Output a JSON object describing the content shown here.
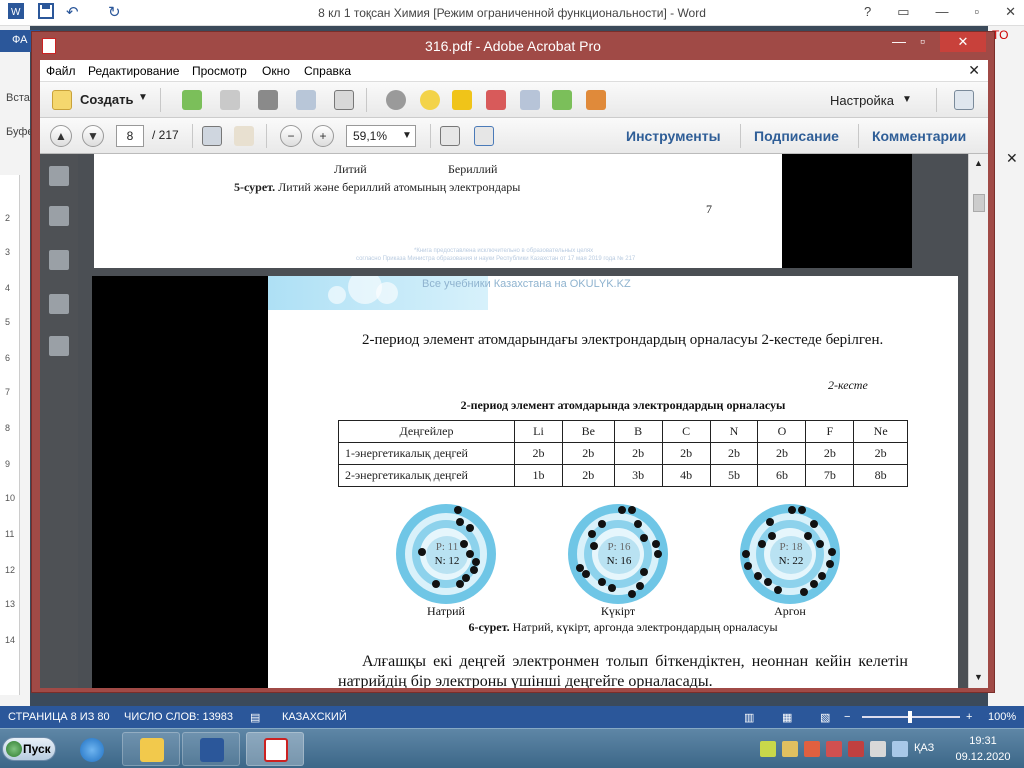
{
  "word": {
    "title": "8 кл 1 тоқсан Химия [Режим ограниченной функциональности] - Word",
    "file_tab": "ФА",
    "paste_label": "Вста",
    "buffer_label": "Буфе",
    "help": "?",
    "pdf_letter": "TO"
  },
  "acrobat": {
    "title": "316.pdf - Adobe Acrobat Pro",
    "menu": [
      "Файл",
      "Редактирование",
      "Просмотр",
      "Окно",
      "Справка"
    ],
    "create_label": "Создать",
    "settings_label": "Настройка",
    "page_current": "8",
    "page_total": "/ 217",
    "zoom": "59,1%",
    "links": [
      "Инструменты",
      "Подписание",
      "Комментарии"
    ]
  },
  "page1": {
    "labels": [
      "Литий",
      "Бериллий"
    ],
    "caption_bold": "5-сурет.",
    "caption_rest": " Литий және бериллий атомының электрондары",
    "page_number": "7",
    "watermark_line1": "*Книга предоставлена исключительно в образовательных целях",
    "watermark_line2": "согласно Приказа Министра образования и науки Республики Казахстан от 17 мая 2019 года № 217"
  },
  "page2": {
    "banner_text": "Все учебники Казахстана на OKULYK.KZ",
    "intro": "2-период элемент атомдарындағы электрондардың орналасуы 2-кестеде берілген.",
    "table_label": "2-кесте",
    "table_caption": "2-период элемент атомдарында электрондардың орналасуы",
    "table_header": [
      "Деңгейлер",
      "Li",
      "Be",
      "B",
      "C",
      "N",
      "O",
      "F",
      "Ne"
    ],
    "table_rows": [
      [
        "1-энергетикалық деңгей",
        "2b",
        "2b",
        "2b",
        "2b",
        "2b",
        "2b",
        "2b",
        "2b"
      ],
      [
        "2-энергетикалық деңгей",
        "1b",
        "2b",
        "3b",
        "4b",
        "5b",
        "6b",
        "7b",
        "8b"
      ]
    ],
    "atoms": [
      {
        "name": "Натрий",
        "p": "P: 11",
        "n": "N: 12"
      },
      {
        "name": "Күкірт",
        "p": "P: 16",
        "n": "N: 16"
      },
      {
        "name": "Аргон",
        "p": "P: 18",
        "n": "N: 22"
      }
    ],
    "fig_caption_bold": "6-сурет.",
    "fig_caption_rest": " Натрий, күкірт, аргонда электрондардың орналасуы",
    "closing": "Алғашқы екі деңгей электронмен толып біткендіктен, неоннан кейін келетін натрийдің бір электроны үшінші деңгейге орналасады."
  },
  "status": {
    "page": "СТРАНИЦА 8 ИЗ 80",
    "words": "ЧИСЛО СЛОВ: 13983",
    "lang": "КАЗАХСКИЙ",
    "zoom": "100%",
    "zoom_fraction": 0.5
  },
  "taskbar": {
    "start": "Пуск",
    "lang": "ҚАЗ",
    "time": "19:31",
    "date": "09.12.2020"
  },
  "colors": {
    "word_blue": "#2b579a",
    "acrobat_frame": "#a04a46",
    "link_blue": "#2f5e97"
  }
}
